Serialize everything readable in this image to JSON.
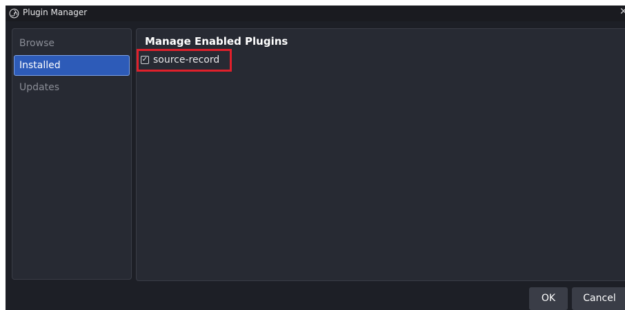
{
  "window": {
    "title": "Plugin Manager",
    "close_glyph": "✕",
    "icon": "obs-logo-icon"
  },
  "sidebar": {
    "items": [
      {
        "label": "Browse",
        "active": false
      },
      {
        "label": "Installed",
        "active": true
      },
      {
        "label": "Updates",
        "active": false
      }
    ]
  },
  "main": {
    "title": "Manage Enabled Plugins",
    "plugins": [
      {
        "name": "source-record",
        "enabled": true
      }
    ]
  },
  "footer": {
    "ok_label": "OK",
    "cancel_label": "Cancel"
  },
  "colors": {
    "accent": "#2d5bb8",
    "highlight": "#e0202b",
    "background": "#1d1f26",
    "panel": "#272a33"
  }
}
